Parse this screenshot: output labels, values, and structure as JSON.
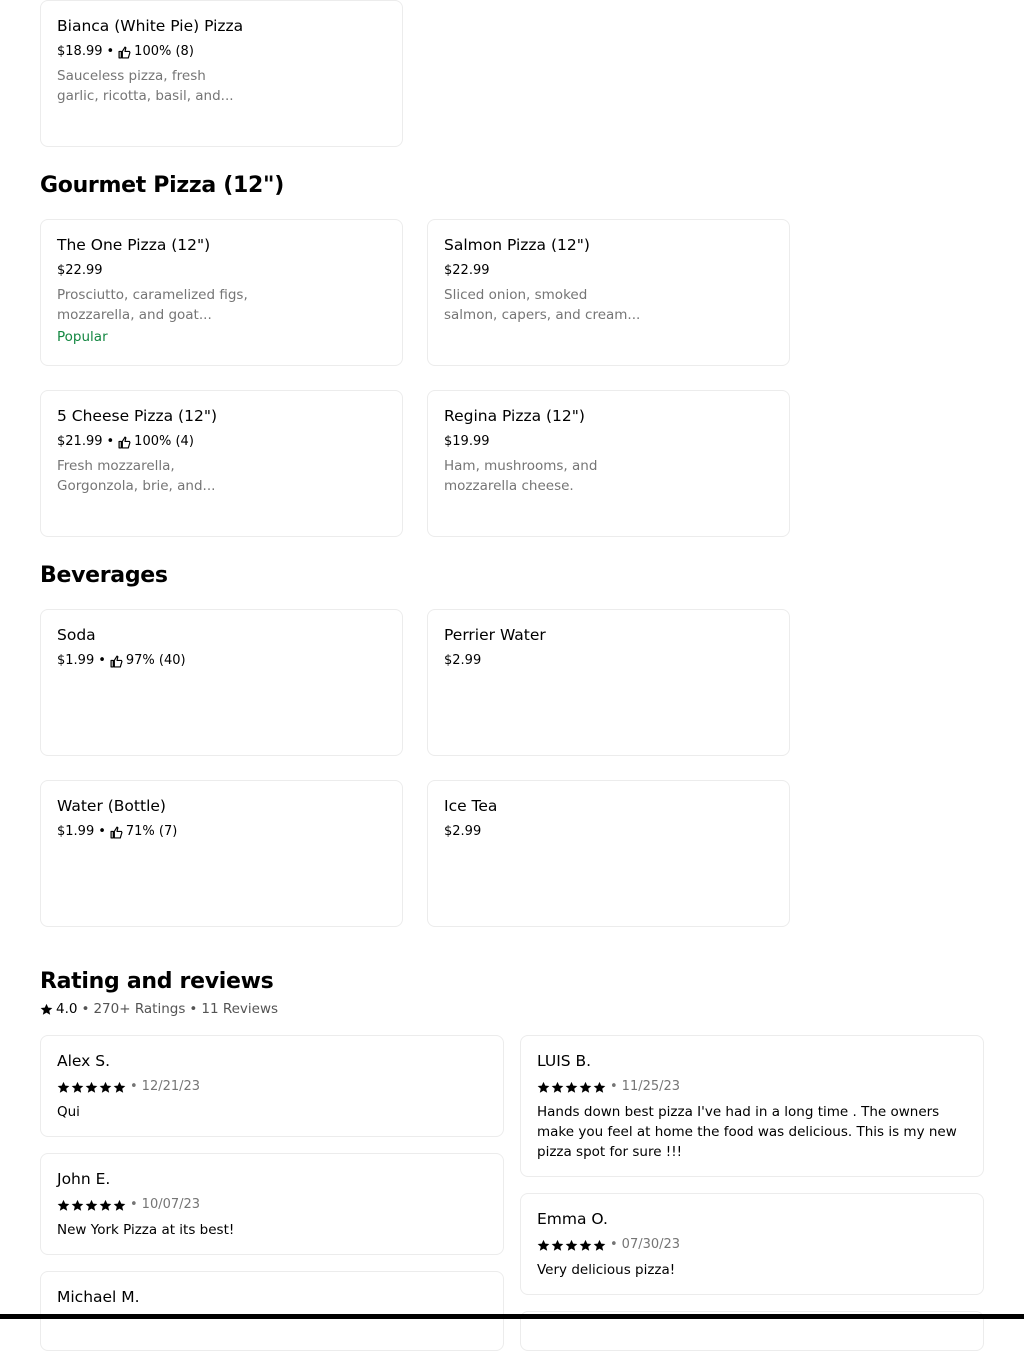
{
  "items_top": [
    {
      "name": "Bianca (White Pie) Pizza",
      "price": "$18.99",
      "rating": "100% (8)",
      "desc1": "Sauceless pizza, fresh",
      "desc2": "garlic, ricotta, basil, and..."
    }
  ],
  "gourmet": {
    "title": "Gourmet Pizza (12\")",
    "items": [
      {
        "name": "The One Pizza (12\")",
        "price": "$22.99",
        "desc1": "Prosciutto, caramelized figs,",
        "desc2": "mozzarella, and goat...",
        "badge": "Popular"
      },
      {
        "name": "Salmon Pizza (12\")",
        "price": "$22.99",
        "desc1": "Sliced onion, smoked",
        "desc2": "salmon, capers, and cream..."
      },
      {
        "name": "5 Cheese Pizza (12\")",
        "price": "$21.99",
        "rating": "100% (4)",
        "desc1": "Fresh mozzarella,",
        "desc2": "Gorgonzola, brie, and..."
      },
      {
        "name": "Regina Pizza (12\")",
        "price": "$19.99",
        "desc1": "Ham, mushrooms, and",
        "desc2": "mozzarella cheese."
      }
    ]
  },
  "beverages": {
    "title": "Beverages",
    "items": [
      {
        "name": "Soda",
        "price": "$1.99",
        "rating": "97% (40)"
      },
      {
        "name": "Perrier Water",
        "price": "$2.99"
      },
      {
        "name": "Water (Bottle)",
        "price": "$1.99",
        "rating": "71% (7)"
      },
      {
        "name": "Ice Tea",
        "price": "$2.99"
      }
    ]
  },
  "reviews": {
    "title": "Rating and reviews",
    "score": "4.0",
    "ratings_count": "270+ Ratings",
    "reviews_count": "11 Reviews",
    "separator": "•",
    "items": [
      {
        "name": "Alex S.",
        "date": "12/21/23",
        "stars": 5,
        "text": "Qui"
      },
      {
        "name": "LUIS B.",
        "date": "11/25/23",
        "stars": 5,
        "text": "Hands down best pizza I've had in a long time . The owners make you feel at home the food was delicious. This is my new pizza spot for sure !!!"
      },
      {
        "name": "John E.",
        "date": "10/07/23",
        "stars": 5,
        "text": "New York Pizza at its best!"
      },
      {
        "name": "Emma O.",
        "date": "07/30/23",
        "stars": 5,
        "text": "Very delicious pizza!"
      },
      {
        "name": "Michael M."
      }
    ]
  },
  "icons": {
    "like": "thumbs-up-icon",
    "star": "star-icon"
  },
  "colors": {
    "popular": "#138741",
    "muted": "#757575",
    "border": "#ececec"
  }
}
